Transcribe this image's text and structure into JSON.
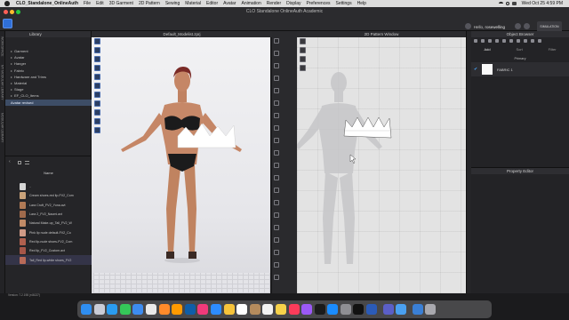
{
  "menubar": {
    "app_name": "CLO_Standalone_OnlineAuth",
    "items": [
      "File",
      "Edit",
      "3D Garment",
      "2D Pattern",
      "Sewing",
      "Material",
      "Editor",
      "Avatar",
      "Animation",
      "Render",
      "Display",
      "Preferences",
      "Settings",
      "Help"
    ],
    "clock": "Wed Oct 25  4:59 PM"
  },
  "window": {
    "title": "CLO Standalone OnlineAuth Academic"
  },
  "header": {
    "greeting_prefix": "Hello, ",
    "username": "rosewelling",
    "simulation_label": "SIMULATION"
  },
  "left_rail": {
    "labels": [
      "WORKSPACE",
      "MY MODULAR LIBRARY",
      "MODULAR LIBRARY"
    ]
  },
  "library": {
    "title": "Library",
    "tree": [
      {
        "label": "Garment",
        "expanded": false
      },
      {
        "label": "Avatar",
        "expanded": false
      },
      {
        "label": "Hanger",
        "expanded": false
      },
      {
        "label": "Fabric",
        "expanded": false
      },
      {
        "label": "Hardware and Trims",
        "expanded": false
      },
      {
        "label": "Material",
        "expanded": false
      },
      {
        "label": "Stage",
        "expanded": false
      },
      {
        "label": "EF_CLO_Items",
        "expanded": false
      },
      {
        "label": "Avatar revised",
        "selected": true
      }
    ],
    "files_header": "Name",
    "files": [
      {
        "label": "..",
        "color": "#d6d6d6"
      },
      {
        "label": "Cream shoes-red lip-FV2_Com",
        "color": "#c9a27a"
      },
      {
        "label": "Lara Croft_FV2_Yuna.avt",
        "color": "#b07a56"
      },
      {
        "label": "Lara 2_FV2_Naomi.avt",
        "color": "#a06a4c"
      },
      {
        "label": "Natural Make-up_Tall_FV2_W",
        "color": "#c08a66"
      },
      {
        "label": "Pink lip nude default-FV2_Co",
        "color": "#d09a86"
      },
      {
        "label": "Red lip-nude shoes-FV2_Com",
        "color": "#b0604e"
      },
      {
        "label": "Red lip_FV2_Custom.avt",
        "color": "#a65648"
      },
      {
        "label": "Tall_Red lip-white shoes_FV2",
        "color": "#b86a58",
        "selected": true
      }
    ],
    "version": "Version: 7.2.198 (r46137)"
  },
  "viewport3d": {
    "title": "Default_Modelist.zprj"
  },
  "viewport2d": {
    "title": "2D Pattern Window"
  },
  "object_browser": {
    "title": "Object Browser",
    "tabs": [
      "Add",
      "Sort",
      "Filter"
    ],
    "section": "Primary",
    "fabric_name": "FABRIC 1",
    "fabric_color": "#fafafa"
  },
  "property_editor": {
    "title": "Property Editor"
  },
  "dock": {
    "icons": [
      "finder",
      "launchpad",
      "safari",
      "messages",
      "mail",
      "chrome",
      "firefox",
      "illustrator",
      "photoshop",
      "indesign",
      "zoom",
      "photos",
      "calendar",
      "contacts",
      "reminders",
      "notes",
      "music",
      "podcasts",
      "tv",
      "appstore",
      "settings",
      "clo",
      "word",
      "teams",
      "preview",
      "downloads",
      "trash"
    ],
    "colors": [
      "#2f8ef0",
      "#c9ccd6",
      "#2a9cf0",
      "#35c759",
      "#3d8cf0",
      "#e9e9e9",
      "#ff8a2a",
      "#ff9a00",
      "#0f5ea8",
      "#f03a7a",
      "#2d8cff",
      "#f6c33a",
      "#ffffff",
      "#b48b5d",
      "#f2f2f2",
      "#f7d24a",
      "#fc3c5a",
      "#9b59f6",
      "#1b1b1b",
      "#1a8cff",
      "#8e8e93",
      "#111111",
      "#2b5bb8",
      "#5b5fc7",
      "#4aa0f0",
      "#3a7fd5",
      "#a8a8ae"
    ]
  }
}
